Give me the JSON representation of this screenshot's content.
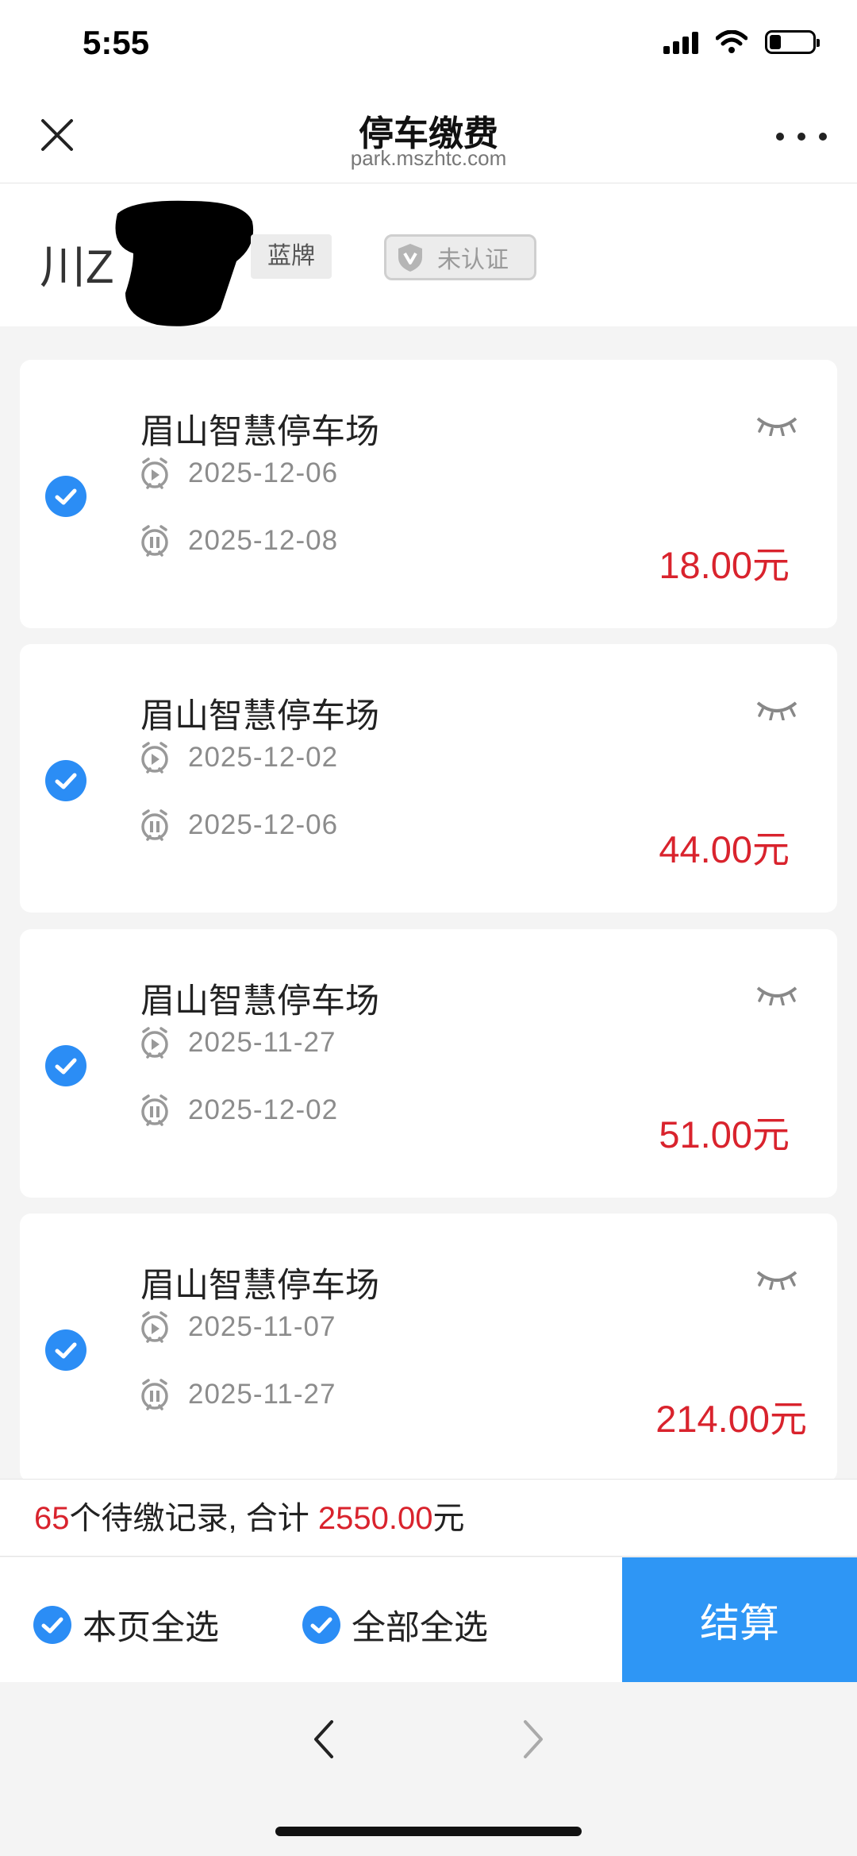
{
  "status_bar": {
    "time": "5:55",
    "icons": [
      "signal-icon",
      "wifi-icon",
      "battery-icon"
    ]
  },
  "nav": {
    "title": "停车缴费",
    "subtitle": "park.mszhtc.com",
    "close_icon": "close-icon",
    "more_icon": "more-icon"
  },
  "plate": {
    "prefix": "川Z",
    "type_tag": "蓝牌",
    "verify_label": "未认证"
  },
  "records": [
    {
      "name": "眉山智慧停车场",
      "start": "2025-12-06",
      "end": "2025-12-08",
      "amount": "18.00元",
      "checked": true
    },
    {
      "name": "眉山智慧停车场",
      "start": "2025-12-02",
      "end": "2025-12-06",
      "amount": "44.00元",
      "checked": true
    },
    {
      "name": "眉山智慧停车场",
      "start": "2025-11-27",
      "end": "2025-12-02",
      "amount": "51.00元",
      "checked": true
    },
    {
      "name": "眉山智慧停车场",
      "start": "2025-11-07",
      "end": "2025-11-27",
      "amount": "214.00元",
      "checked": true
    }
  ],
  "summary": {
    "count": "65",
    "count_suffix": "个待缴记录, 合计 ",
    "total": "2550.00",
    "unit": "元"
  },
  "actions": {
    "select_page": "本页全选",
    "select_all": "全部全选",
    "checkout": "结算"
  },
  "colors": {
    "accent_blue": "#2b8df5",
    "amount_red": "#d9232d",
    "checkout_blue": "#2e96f5"
  }
}
